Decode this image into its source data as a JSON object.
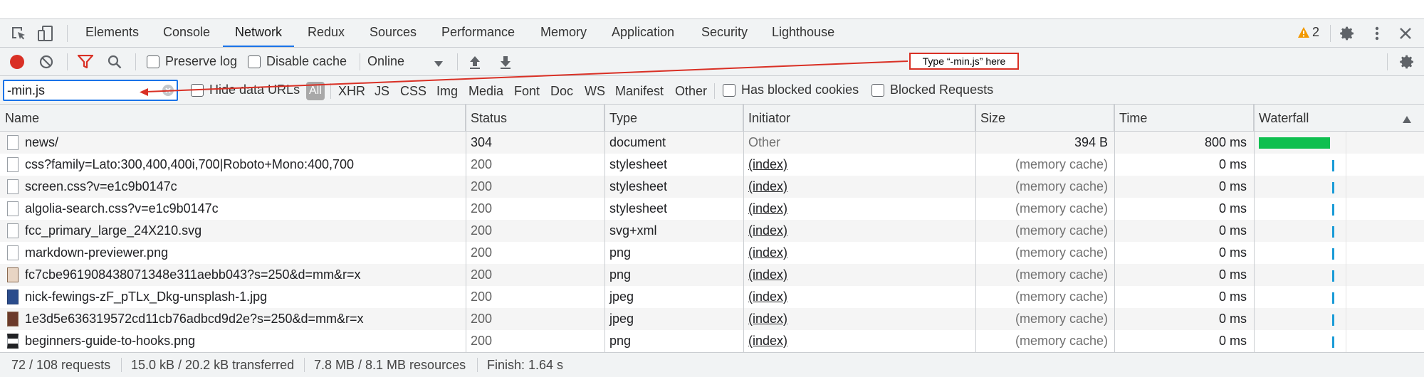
{
  "tabs": [
    {
      "label": "Elements"
    },
    {
      "label": "Console"
    },
    {
      "label": "Network"
    },
    {
      "label": "Redux"
    },
    {
      "label": "Sources"
    },
    {
      "label": "Performance"
    },
    {
      "label": "Memory"
    },
    {
      "label": "Application"
    },
    {
      "label": "Security"
    },
    {
      "label": "Lighthouse"
    }
  ],
  "warnings": {
    "count": "2",
    "color": "#f29900"
  },
  "toolbar": {
    "preserve_log": "Preserve log",
    "disable_cache": "Disable cache",
    "throttle": "Online",
    "preserve_checked": false,
    "disable_checked": false
  },
  "annotation": {
    "text": "Type “-min.js” here",
    "color": "#d93025"
  },
  "filter": {
    "value": "-min.js",
    "hide_data_urls": "Hide data URLs",
    "types": [
      "All",
      "XHR",
      "JS",
      "CSS",
      "Img",
      "Media",
      "Font",
      "Doc",
      "WS",
      "Manifest",
      "Other"
    ],
    "blocked_cookies": "Has blocked cookies",
    "blocked_requests": "Blocked Requests"
  },
  "columns": [
    "Name",
    "Status",
    "Type",
    "Initiator",
    "Size",
    "Time",
    "Waterfall"
  ],
  "rows": [
    {
      "name": "news/",
      "status": "304",
      "type": "document",
      "initiator": "Other",
      "size": "394 B",
      "time": "800 ms",
      "icon": "document-icon"
    },
    {
      "name": "css?family=Lato:300,400,400i,700|Roboto+Mono:400,700",
      "status": "200",
      "type": "stylesheet",
      "initiator": "(index)",
      "size": "(memory cache)",
      "time": "0 ms",
      "icon": "stylesheet-icon"
    },
    {
      "name": "screen.css?v=e1c9b0147c",
      "status": "200",
      "type": "stylesheet",
      "initiator": "(index)",
      "size": "(memory cache)",
      "time": "0 ms",
      "icon": "stylesheet-icon"
    },
    {
      "name": "algolia-search.css?v=e1c9b0147c",
      "status": "200",
      "type": "stylesheet",
      "initiator": "(index)",
      "size": "(memory cache)",
      "time": "0 ms",
      "icon": "stylesheet-icon"
    },
    {
      "name": "fcc_primary_large_24X210.svg",
      "status": "200",
      "type": "svg+xml",
      "initiator": "(index)",
      "size": "(memory cache)",
      "time": "0 ms",
      "icon": "svg-file-icon"
    },
    {
      "name": "markdown-previewer.png",
      "status": "200",
      "type": "png",
      "initiator": "(index)",
      "size": "(memory cache)",
      "time": "0 ms",
      "icon": "image-file-icon"
    },
    {
      "name": "fc7cbe961908438071348e311aebb043?s=250&d=mm&r=x",
      "status": "200",
      "type": "png",
      "initiator": "(index)",
      "size": "(memory cache)",
      "time": "0 ms",
      "icon": "avatar-thumbnail-icon"
    },
    {
      "name": "nick-fewings-zF_pTLx_Dkg-unsplash-1.jpg",
      "status": "200",
      "type": "jpeg",
      "initiator": "(index)",
      "size": "(memory cache)",
      "time": "0 ms",
      "icon": "photo-thumbnail-icon"
    },
    {
      "name": "1e3d5e636319572cd11cb76adbcd9d2e?s=250&d=mm&r=x",
      "status": "200",
      "type": "jpeg",
      "initiator": "(index)",
      "size": "(memory cache)",
      "time": "0 ms",
      "icon": "avatar-thumbnail-icon"
    },
    {
      "name": "beginners-guide-to-hooks.png",
      "status": "200",
      "type": "png",
      "initiator": "(index)",
      "size": "(memory cache)",
      "time": "0 ms",
      "icon": "image-thumbnail-icon"
    }
  ],
  "statusbar": {
    "requests": "72 / 108 requests",
    "transferred": "15.0 kB / 20.2 kB transferred",
    "resources": "7.8 MB / 8.1 MB resources",
    "finish": "Finish: 1.64 s"
  },
  "colors": {
    "accent": "#1a73e8",
    "record": "#d93025",
    "waterfall_bar": "#0fbf4f",
    "waterfall_tick": "#1a9bd7"
  }
}
